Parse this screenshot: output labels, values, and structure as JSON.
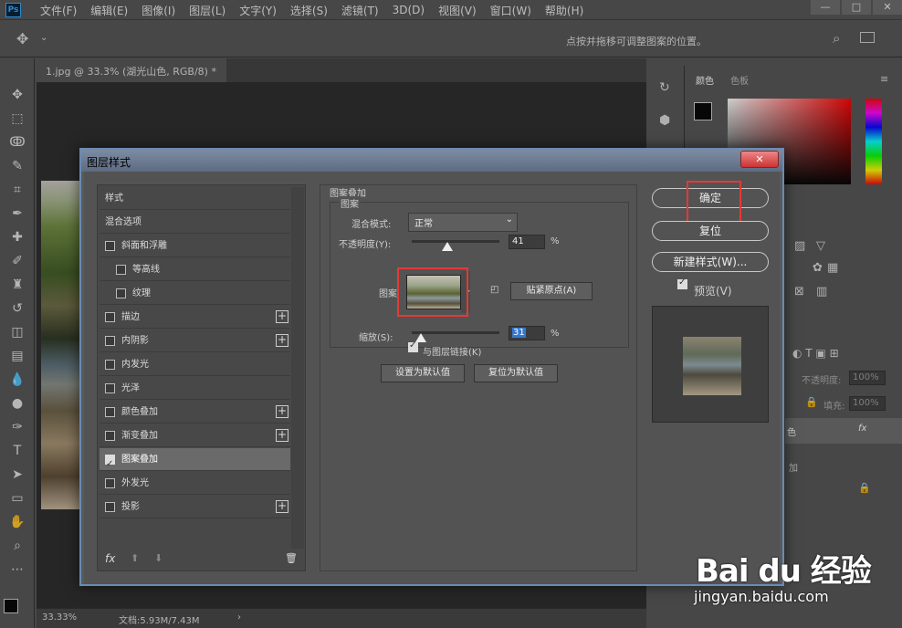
{
  "menubar": {
    "app_icon": "Ps",
    "menus": [
      "文件(F)",
      "编辑(E)",
      "图像(I)",
      "图层(L)",
      "文字(Y)",
      "选择(S)",
      "滤镜(T)",
      "3D(D)",
      "视图(V)",
      "窗口(W)",
      "帮助(H)"
    ]
  },
  "options_bar": {
    "hint": "点按并拖移可调整图案的位置。"
  },
  "document": {
    "tab_label": "1.jpg @ 33.3% (湖光山色, RGB/8) *",
    "zoom": "33.33%",
    "doc_info": "文档:5.93M/7.43M"
  },
  "color_panel": {
    "tabs": [
      "颜色",
      "色板"
    ],
    "foreground": "#000000",
    "background": "#ffffff"
  },
  "layers_panel": {
    "opacity_label": "不透明度:",
    "opacity_value": "100%",
    "fill_label": "填充:",
    "fill_value": "100%",
    "layer_name_fragment": "色",
    "effect_fragment": "加"
  },
  "dialog": {
    "title": "图层样式",
    "close_label": "✕",
    "styles_header": "样式",
    "blend_options": "混合选项",
    "items": [
      {
        "label": "斜面和浮雕",
        "checked": false,
        "plus": false,
        "indent": false
      },
      {
        "label": "等高线",
        "checked": false,
        "plus": false,
        "indent": true
      },
      {
        "label": "纹理",
        "checked": false,
        "plus": false,
        "indent": true
      },
      {
        "label": "描边",
        "checked": false,
        "plus": true,
        "indent": false
      },
      {
        "label": "内阴影",
        "checked": false,
        "plus": true,
        "indent": false
      },
      {
        "label": "内发光",
        "checked": false,
        "plus": false,
        "indent": false
      },
      {
        "label": "光泽",
        "checked": false,
        "plus": false,
        "indent": false
      },
      {
        "label": "颜色叠加",
        "checked": false,
        "plus": true,
        "indent": false
      },
      {
        "label": "渐变叠加",
        "checked": false,
        "plus": true,
        "indent": false
      },
      {
        "label": "图案叠加",
        "checked": true,
        "plus": false,
        "indent": false,
        "selected": true
      },
      {
        "label": "外发光",
        "checked": false,
        "plus": false,
        "indent": false
      },
      {
        "label": "投影",
        "checked": false,
        "plus": true,
        "indent": false
      }
    ],
    "fx_label": "fx",
    "section_title": "图案叠加",
    "subsection_title": "图案",
    "blend_mode_label": "混合模式:",
    "blend_mode_value": "正常",
    "opacity_label": "不透明度(Y):",
    "opacity_value": "41",
    "opacity_fraction": 0.41,
    "percent": "%",
    "pattern_label": "图案",
    "snap_origin": "贴紧原点(A)",
    "scale_label": "缩放(S):",
    "scale_value": "31",
    "scale_fraction": 0.1,
    "link_label": "与图层链接(K)",
    "link_checked": true,
    "set_default": "设置为默认值",
    "reset_default": "复位为默认值",
    "ok": "确定",
    "reset": "复位",
    "new_style": "新建样式(W)...",
    "preview_label": "预览(V)",
    "preview_checked": true
  },
  "watermark": {
    "brand": "Bai du 经验",
    "url": "jingyan.baidu.com"
  },
  "colors": {
    "highlight": "#e53935",
    "dialog_border": "#6b8ab3"
  }
}
